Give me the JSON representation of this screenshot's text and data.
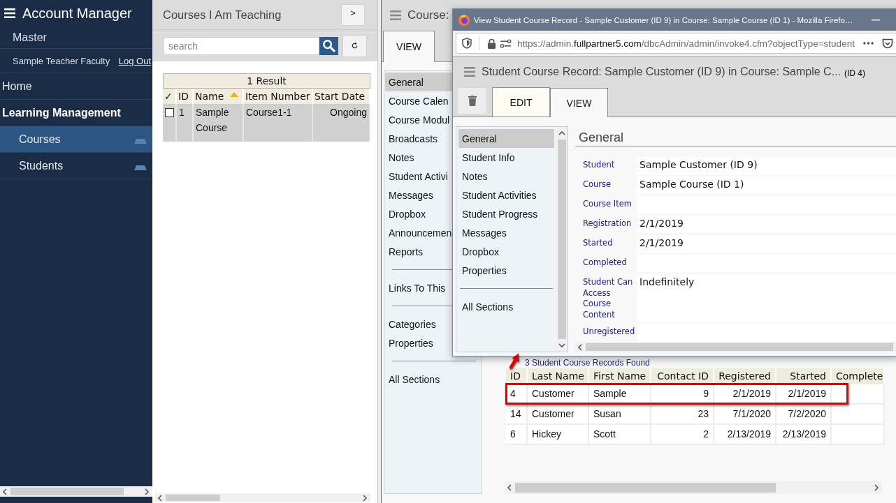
{
  "sidebar": {
    "title": "Account Manager",
    "account": "Master",
    "user": "Sample Teacher Faculty",
    "logout": "Log Out",
    "items": [
      {
        "label": "Home",
        "kind": "link",
        "selected": false
      },
      {
        "label": "Learning Management",
        "kind": "section",
        "selected": false
      },
      {
        "label": "Courses",
        "kind": "module",
        "selected": true
      },
      {
        "label": "Students",
        "kind": "module",
        "selected": false
      }
    ]
  },
  "courses_panel": {
    "title": "Courses I Am Teaching",
    "expand_button": ">",
    "search": {
      "placeholder": "search"
    },
    "table": {
      "caption": "1 Result",
      "columns": [
        {
          "label": "✓",
          "sorted": false
        },
        {
          "label": "ID",
          "sorted": false
        },
        {
          "label": "Name",
          "sorted": true
        },
        {
          "label": "Item Number",
          "sorted": false
        },
        {
          "label": "Start Date",
          "sorted": false
        }
      ],
      "rows": [
        {
          "checked": false,
          "selected": true,
          "cells": [
            "",
            "1",
            "Sample Course",
            "Course1-1",
            "Ongoing"
          ]
        }
      ]
    }
  },
  "course_panel": {
    "title": "Course:",
    "tabs": [
      {
        "label": "VIEW",
        "selected": true
      }
    ],
    "nav": [
      {
        "items": [
          {
            "label": "General",
            "selected": true
          },
          {
            "label": "Course Calen",
            "selected": false
          },
          {
            "label": "Course Modul",
            "selected": false
          },
          {
            "label": "Broadcasts",
            "selected": false
          },
          {
            "label": "Notes",
            "selected": false
          },
          {
            "label": "Student Activi",
            "selected": false
          },
          {
            "label": "Messages",
            "selected": false
          },
          {
            "label": "Dropbox",
            "selected": false
          },
          {
            "label": "Announcemen",
            "selected": false
          },
          {
            "label": "Reports",
            "selected": false
          }
        ]
      },
      {
        "items": [
          {
            "label": "Links To This",
            "selected": false
          }
        ]
      },
      {
        "items": [
          {
            "label": "Categories",
            "selected": false
          },
          {
            "label": "Properties",
            "selected": false
          }
        ]
      },
      {
        "items": [
          {
            "label": "All Sections",
            "selected": false
          }
        ]
      }
    ]
  },
  "records": {
    "summary": "3 Student Course Records Found",
    "columns": [
      "ID",
      "Last Name",
      "First Name",
      "Contact ID",
      "Registered",
      "Started",
      "Complete"
    ],
    "rows": [
      {
        "highlighted": true,
        "cells": [
          "4",
          "Customer",
          "Sample",
          "9",
          "2/1/2019",
          "2/1/2019"
        ]
      },
      {
        "highlighted": false,
        "cells": [
          "14",
          "Customer",
          "Susan",
          "23",
          "7/1/2020",
          "7/2/2020"
        ]
      },
      {
        "highlighted": false,
        "cells": [
          "6",
          "Hickey",
          "Scott",
          "2",
          "2/13/2019",
          "2/13/2019"
        ]
      }
    ]
  },
  "popup": {
    "window_title": "View Student Course Record - Sample Customer (ID 9) in Course: Sample Course (ID 1) - Mozilla Firefo…",
    "url": {
      "host_prefix": "https://admin.",
      "domain": "fullpartner5.com",
      "path": "/dbcAdmin/admin/invoke4.cfm?objectType=student"
    },
    "heading": "Student Course Record: Sample Customer (ID 9) in Course: Sample C...",
    "record_id": "(ID 4)",
    "tabs": [
      {
        "label": "EDIT",
        "selected": false
      },
      {
        "label": "VIEW",
        "selected": true
      }
    ],
    "nav": [
      {
        "items": [
          {
            "label": "General",
            "selected": true
          },
          {
            "label": "Student Info",
            "selected": false
          },
          {
            "label": "Notes",
            "selected": false
          },
          {
            "label": "Student Activities",
            "selected": false
          },
          {
            "label": "Student Progress",
            "selected": false
          },
          {
            "label": "Messages",
            "selected": false
          },
          {
            "label": "Dropbox",
            "selected": false
          },
          {
            "label": "Properties",
            "selected": false
          }
        ]
      },
      {
        "items": [
          {
            "label": "All Sections",
            "selected": false
          }
        ]
      }
    ],
    "section_title": "General",
    "fields": [
      {
        "label": "Student",
        "value": "Sample Customer (ID 9)"
      },
      {
        "label": "Course",
        "value": "Sample Course (ID 1)"
      },
      {
        "label": "Course Item"
      },
      {
        "label": "Registration",
        "value": "2/1/2019"
      },
      {
        "label": "Started",
        "value": "2/1/2019"
      },
      {
        "label": "Completed"
      },
      {
        "label": "Student Can Access Course Content",
        "value": "Indefinitely"
      },
      {
        "label": "Unregistered"
      }
    ]
  }
}
